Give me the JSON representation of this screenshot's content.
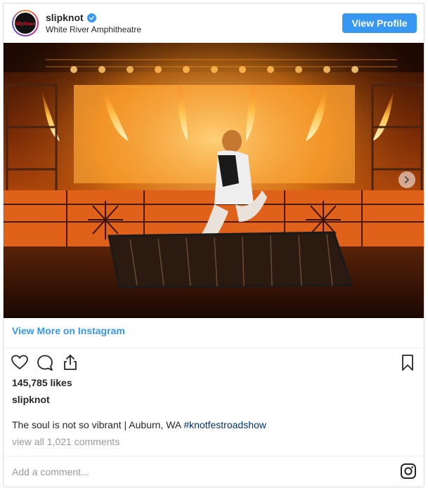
{
  "header": {
    "username": "slipknot",
    "location": "White River Amphitheatre",
    "avatar_text": "Slipknot",
    "view_profile_label": "View Profile",
    "verified_icon": "verified-check-icon"
  },
  "photo": {
    "next_icon": "chevron-right-icon"
  },
  "view_more_label": "View More on Instagram",
  "actions": {
    "like_icon": "heart-icon",
    "comment_icon": "comment-icon",
    "share_icon": "share-icon",
    "save_icon": "bookmark-icon"
  },
  "likes": "145,785 likes",
  "caption": {
    "username": "slipknot",
    "text": "The soul is not so vibrant | Auburn, WA ",
    "hashtag": "#knotfestroadshow"
  },
  "view_comments_label": "view all 1,021 comments",
  "comment_placeholder": "Add a comment...",
  "instagram_icon": "instagram-icon",
  "colors": {
    "accent": "#3897f0",
    "hashtag": "#003569",
    "muted": "#999999",
    "text": "#262626"
  }
}
